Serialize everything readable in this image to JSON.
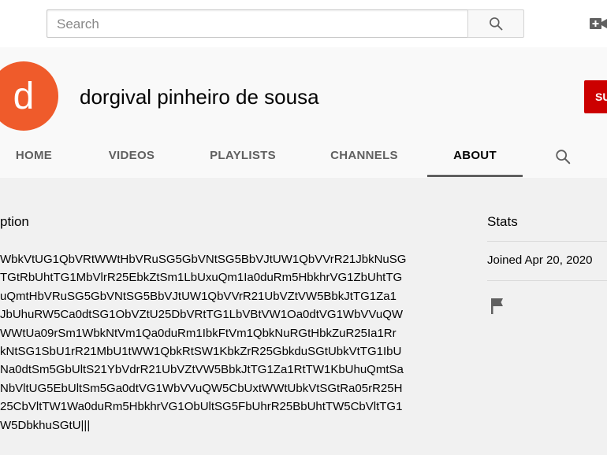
{
  "search": {
    "placeholder": "Search"
  },
  "channel": {
    "avatar_letter": "d",
    "name": "dorgival pinheiro de sousa",
    "subscribe_label": "SU",
    "avatar_color": "#ef5b2b",
    "subscribe_color": "#cc0000"
  },
  "tabs": [
    {
      "label": "HOME",
      "active": false
    },
    {
      "label": "VIDEOS",
      "active": false
    },
    {
      "label": "PLAYLISTS",
      "active": false
    },
    {
      "label": "CHANNELS",
      "active": false
    },
    {
      "label": "ABOUT",
      "active": true
    }
  ],
  "about": {
    "description_title": "ption",
    "description_lines": [
      "WbkVtUG1QbVRtWWtHbVRuSG5GbVNtSG5BbVJtUW1QbVVrR21JbkNuSG",
      "TGtRbUhtTG1MbVlrR25EbkZtSm1LbUxuQm1Ia0duRm5HbkhrVG1ZbUhtTG",
      "uQmtHbVRuSG5GbVNtSG5BbVJtUW1QbVVrR21UbVZtVW5BbkJtTG1Za1",
      "JbUhuRW5Ca0dtSG1ObVZtU25DbVRtTG1LbVBtVW1Oa0dtVG1WbVVuQW",
      "WWtUa09rSm1WbkNtVm1Qa0duRm1IbkFtVm1QbkNuRGtHbkZuR25Ia1Rr",
      "kNtSG1SbU1rR21MbU1tWW1QbkRtSW1KbkZrR25GbkduSGtUbkVtTG1IbU",
      "Na0dtSm5GbUltS21YbVdrR21UbVZtVW5BbkJtTG1Za1RtTW1KbUhuQmtSa",
      "NbVltUG5EbUltSm5Ga0dtVG1WbVVuQW5CbUxtWWtUbkVtSGtRa05rR25H",
      "25CbVltTW1Wa0duRm5HbkhrVG1ObUltSG5FbUhrR25BbUhtTW5CbVltTG1",
      "W5DbkhuSGtU|||"
    ]
  },
  "stats": {
    "title": "Stats",
    "joined": "Joined Apr 20, 2020"
  },
  "icons": {
    "search_button": "search-icon",
    "create": "video-camera-plus-icon",
    "tab_search": "search-icon",
    "report": "flag-icon"
  }
}
